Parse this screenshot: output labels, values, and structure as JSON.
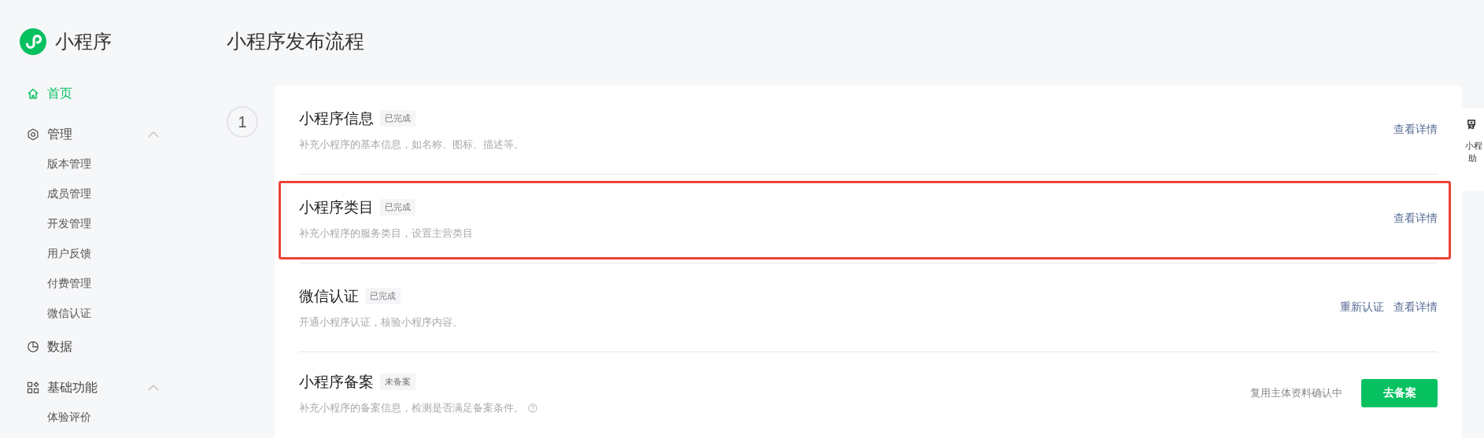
{
  "brand": {
    "name": "小程序"
  },
  "sidebar": {
    "items": [
      {
        "label": "首页",
        "kind": "home",
        "selected": true
      },
      {
        "label": "管理",
        "kind": "gear",
        "selected": false,
        "expanded": true,
        "children": [
          {
            "label": "版本管理",
            "selected": false
          },
          {
            "label": "成员管理",
            "selected": false
          },
          {
            "label": "开发管理",
            "selected": false
          },
          {
            "label": "用户反馈",
            "selected": false
          },
          {
            "label": "付费管理",
            "selected": false
          },
          {
            "label": "微信认证",
            "selected": false
          }
        ]
      },
      {
        "label": "数据",
        "kind": "pie",
        "selected": false
      },
      {
        "label": "基础功能",
        "kind": "grid",
        "selected": false,
        "expanded": true,
        "children": [
          {
            "label": "体验评价",
            "selected": false
          }
        ]
      }
    ]
  },
  "page": {
    "title": "小程序发布流程"
  },
  "step": {
    "number": "1"
  },
  "rows": [
    {
      "title": "小程序信息",
      "status": "已完成",
      "description": "补充小程序的基本信息，如名称、图标、描述等。",
      "highlighted": false,
      "links": [
        "查看详情"
      ]
    },
    {
      "title": "小程序类目",
      "status": "已完成",
      "description": "补充小程序的服务类目，设置主营类目",
      "highlighted": true,
      "links": [
        "查看详情"
      ]
    },
    {
      "title": "微信认证",
      "status": "已完成",
      "description": "开通小程序认证，核验小程序内容。",
      "highlighted": false,
      "links": [
        "重新认证",
        "查看详情"
      ]
    },
    {
      "title": "小程序备案",
      "status": "未备案",
      "description": "补充小程序的备案信息，检测是否满足备案条件。",
      "help": true,
      "highlighted": false,
      "note": "复用主体资料确认中",
      "button": "去备案"
    }
  ],
  "side_panel": {
    "lines": [
      "小程",
      "助"
    ]
  }
}
